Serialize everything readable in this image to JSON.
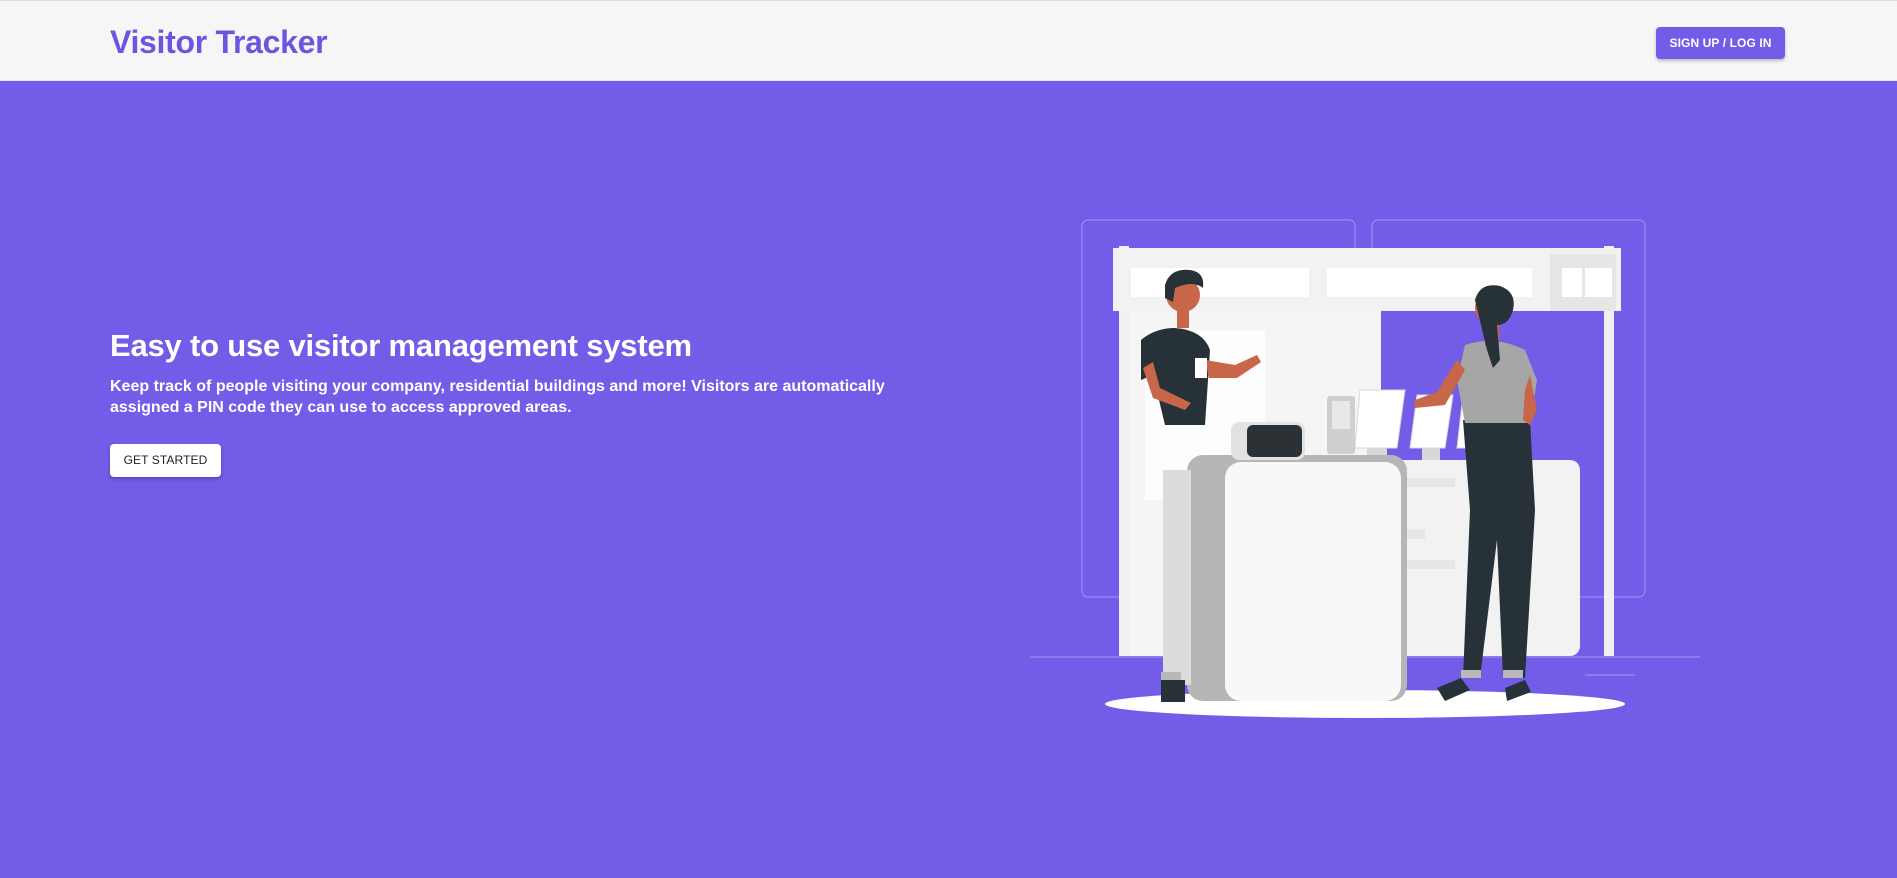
{
  "header": {
    "brand": "Visitor Tracker",
    "auth_button_label": "SIGN UP / LOG IN"
  },
  "hero": {
    "title": "Easy to use visitor management system",
    "description": "Keep track of people visiting your company, residential buildings and more! Visitors are automatically assigned a PIN code they can use to access approved areas.",
    "cta_label": "GET STARTED"
  },
  "colors": {
    "accent": "#735ce8",
    "brand_text": "#6d55e0",
    "navbar_bg": "#f6f6f6",
    "button_light_bg": "#ffffff"
  },
  "illustration": {
    "icon": "reception-desk-illustration"
  }
}
